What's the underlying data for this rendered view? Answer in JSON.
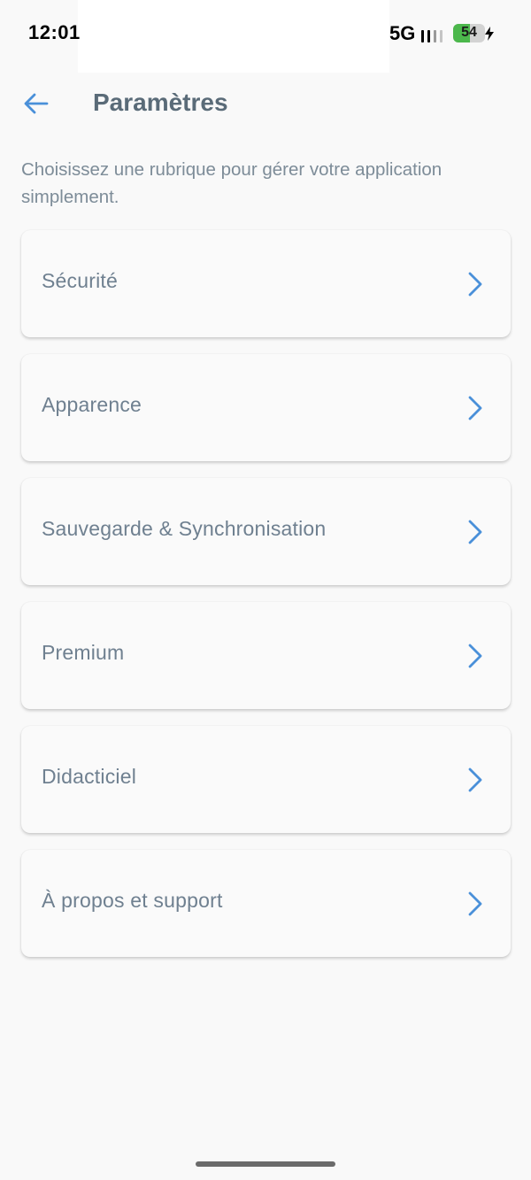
{
  "status_bar": {
    "time": "12:01",
    "network": "5G",
    "battery_level": "54",
    "battery_fraction": 0.54,
    "battery_color": "#4cb84c",
    "signal_icon": "signal-bars-icon",
    "charging_icon": "bolt-icon"
  },
  "header": {
    "back_icon": "arrow-left-icon",
    "title": "Paramètres"
  },
  "intro": "Choisissez une rubrique pour gérer votre application simplement.",
  "menu": {
    "items": [
      {
        "label": "Sécurité",
        "icon": "chevron-right-icon"
      },
      {
        "label": "Apparence",
        "icon": "chevron-right-icon"
      },
      {
        "label": "Sauvegarde & Synchronisation",
        "icon": "chevron-right-icon"
      },
      {
        "label": "Premium",
        "icon": "chevron-right-icon"
      },
      {
        "label": "Didacticiel",
        "icon": "chevron-right-icon"
      },
      {
        "label": "À propos et support",
        "icon": "chevron-right-icon"
      }
    ]
  },
  "colors": {
    "accent": "#4a90d9",
    "background": "#f9f9f9",
    "title": "#5a6b78",
    "text": "#6f8090"
  }
}
